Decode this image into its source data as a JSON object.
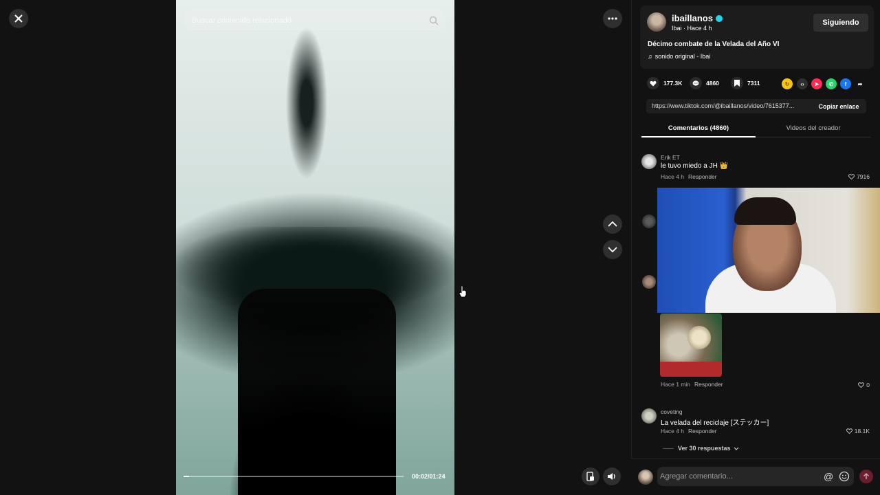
{
  "player": {
    "search_placeholder": "Buscar contenido relacionado",
    "time": "00:02/01:24",
    "progress_fraction": 0.024
  },
  "author": {
    "name": "ibaillanos",
    "sub": "Ibai · Hace 4 h",
    "follow_label": "Siguiendo",
    "description": "Décimo combate de la Velada del Año VI",
    "sound": "sonido original - Ibai"
  },
  "actions": {
    "likes": "177.3K",
    "comments": "4860",
    "saves": "7311"
  },
  "share": {
    "url": "https://www.tiktok.com/@ibaillanos/video/7615377...",
    "copy_label": "Copiar enlace"
  },
  "tabs": {
    "comments": "Comentarios (4860)",
    "creator_videos": "Videos del creador"
  },
  "comments": [
    {
      "user": "Erik ET",
      "text": "le tuvo miedo a JH 👑",
      "time": "Hace 4 h",
      "reply_label": "Responder",
      "likes": "7916"
    },
    {
      "user": "",
      "text": "",
      "time": "Hace 1 min",
      "reply_label": "Responder",
      "likes": "0"
    },
    {
      "user": "coveting",
      "text": "La velada del reciclaje [ステッカー]",
      "time": "Hace 4 h",
      "reply_label": "Responder",
      "likes": "18.1K"
    }
  ],
  "view_replies": "Ver 30 respuestas",
  "comment_bar": {
    "placeholder": "Agregar comentario..."
  },
  "colors": {
    "accent_verified": "#20d5ec",
    "send_button": "#6a1f2d"
  }
}
